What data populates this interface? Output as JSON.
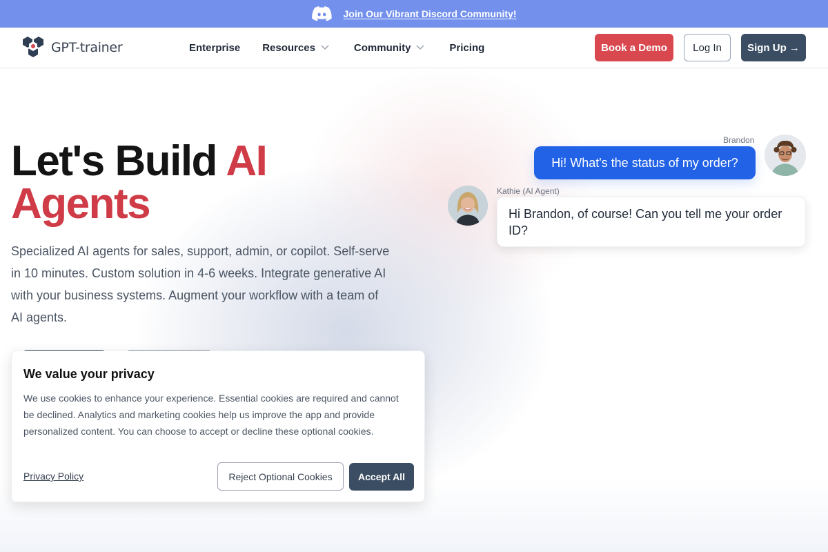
{
  "announcement": {
    "icon": "discord-icon",
    "link_text": "Join Our Vibrant Discord Community!",
    "background": "#7390ec"
  },
  "header": {
    "logo_text": "GPT-trainer",
    "nav": [
      {
        "label": "Enterprise",
        "has_dropdown": false
      },
      {
        "label": "Resources",
        "has_dropdown": true
      },
      {
        "label": "Community",
        "has_dropdown": true
      },
      {
        "label": "Pricing",
        "has_dropdown": false
      }
    ],
    "buttons": {
      "demo": "Book a Demo",
      "login": "Log In",
      "signup": "Sign Up →"
    }
  },
  "hero": {
    "headline_part1": "Let's Build ",
    "headline_accent1": "AI",
    "headline_accent2": "Agents",
    "subtext": "Specialized AI agents for sales, support, admin, or copilot. Self-serve in 10 minutes. Custom solution in 4-6 weeks. Integrate generative AI with your business systems. Augment your workflow with a team of AI agents.",
    "accent_color": "#cf3b46"
  },
  "chat": {
    "messages": [
      {
        "sender": "Brandon",
        "text": "Hi! What's the status of my order?",
        "role": "user",
        "avatar": "brandon-avatar"
      },
      {
        "sender": "Kathie (AI Agent)",
        "text": "Hi Brandon, of course! Can you tell me your order ID?",
        "role": "agent",
        "avatar": "kathie-avatar"
      }
    ],
    "user_bubble_color": "#2262e6"
  },
  "cookie_banner": {
    "title": "We value your privacy",
    "body": "We use cookies to enhance your experience. Essential cookies are required and cannot be declined. Analytics and marketing cookies help us improve the app and provide personalized content. You can choose to accept or decline these optional cookies.",
    "privacy_link": "Privacy Policy",
    "reject_label": "Reject Optional Cookies",
    "accept_label": "Accept All"
  }
}
